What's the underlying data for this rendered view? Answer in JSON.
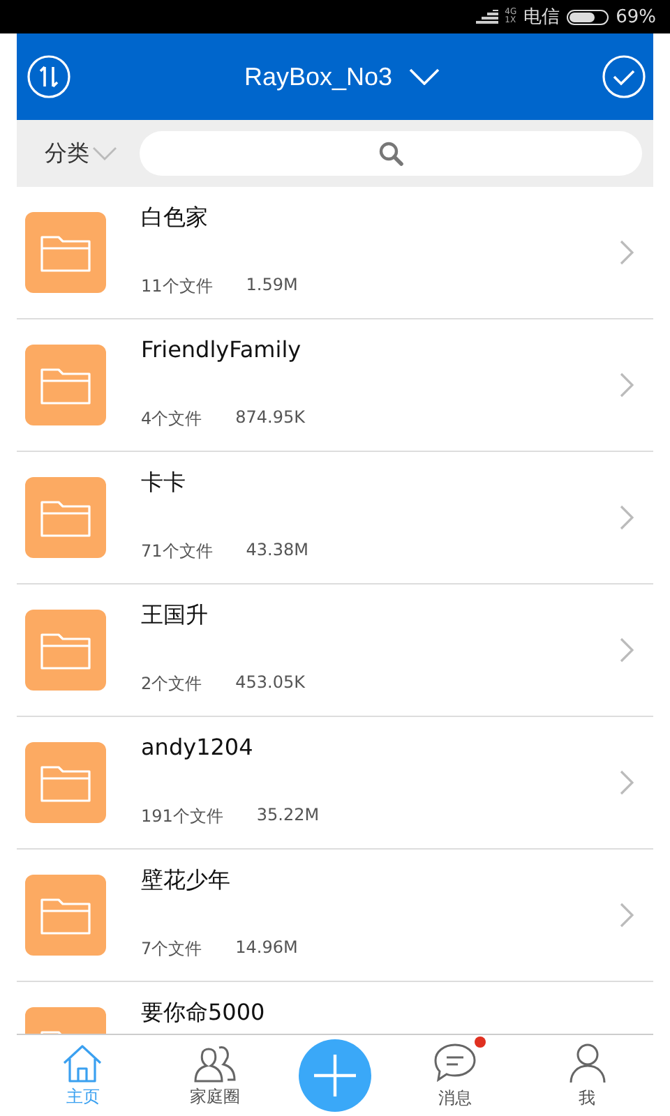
{
  "status_bar": {
    "network_top": "4G",
    "network_bottom": "1X",
    "carrier": "电信",
    "battery": "69%"
  },
  "header": {
    "title": "RayBox_No3"
  },
  "filter": {
    "category": "分类"
  },
  "folders": [
    {
      "name": "白色家",
      "count": "11个文件",
      "size": "1.59M"
    },
    {
      "name": "FriendlyFamily",
      "count": "4个文件",
      "size": "874.95K"
    },
    {
      "name": "卡卡",
      "count": "71个文件",
      "size": "43.38M"
    },
    {
      "name": "王国升",
      "count": "2个文件",
      "size": "453.05K"
    },
    {
      "name": "andy1204",
      "count": "191个文件",
      "size": "35.22M"
    },
    {
      "name": "壁花少年",
      "count": "7个文件",
      "size": "14.96M"
    },
    {
      "name": "要你命5000"
    }
  ],
  "bottom_nav": [
    {
      "kind": "home",
      "label": "主页",
      "selected": true,
      "badge": false
    },
    {
      "kind": "family",
      "label": "家庭圈",
      "selected": false,
      "badge": false
    },
    {
      "kind": "add"
    },
    {
      "kind": "message",
      "label": "消息",
      "selected": false,
      "badge": true
    },
    {
      "kind": "me",
      "label": "我",
      "selected": false,
      "badge": false
    }
  ]
}
